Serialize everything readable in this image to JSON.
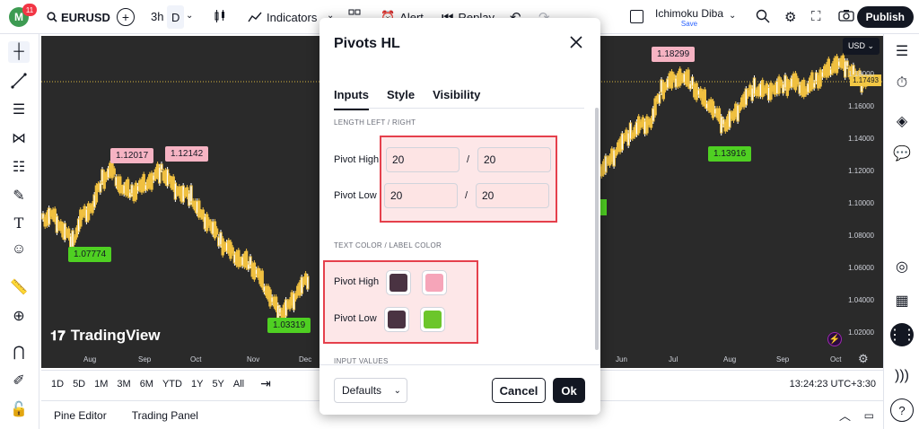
{
  "topbar": {
    "avatar_letter": "M",
    "notifications": "11",
    "symbol": "EURUSD",
    "interval": "3h",
    "interval_d": "D",
    "indicators": "Indicators",
    "alert": "Alert",
    "replay": "Replay",
    "layout_name": "Ichimoku Diba",
    "layout_sub": "Save",
    "publish": "Publish"
  },
  "chart": {
    "currency": "USD",
    "price_tag": "1.17493",
    "price_ticks": [
      "1.18000",
      "1.16000",
      "1.14000",
      "1.12000",
      "1.10000",
      "1.08000",
      "1.06000",
      "1.04000",
      "1.02000"
    ],
    "time_ticks_left": [
      "Aug",
      "Sep",
      "Oct",
      "Nov",
      "Dec"
    ],
    "time_ticks_right": [
      "Jun",
      "Jul",
      "Aug",
      "Sep",
      "Oct"
    ],
    "labels_high": [
      "1.12017",
      "1.12142",
      "1.18299"
    ],
    "labels_low": [
      "1.07774",
      "1.03319",
      "1.13916"
    ],
    "brand": "TradingView"
  },
  "bottom_toolbar": {
    "ranges": [
      "1D",
      "5D",
      "1M",
      "3M",
      "6M",
      "YTD",
      "1Y",
      "5Y",
      "All"
    ],
    "clock": "13:24:23 UTC+3:30"
  },
  "footer": {
    "pine_editor": "Pine Editor",
    "trading_panel": "Trading Panel"
  },
  "dialog": {
    "title": "Pivots HL",
    "tabs": [
      "Inputs",
      "Style",
      "Visibility"
    ],
    "section_length": "LENGTH LEFT / RIGHT",
    "pivot_high_label": "Pivot High",
    "pivot_low_label": "Pivot Low",
    "pivot_high_left": "20",
    "pivot_high_right": "20",
    "pivot_low_left": "20",
    "pivot_low_right": "20",
    "slash": "/",
    "section_color": "TEXT COLOR / LABEL COLOR",
    "color_high_label": "Pivot High",
    "color_low_label": "Pivot Low",
    "section_input_values": "INPUT VALUES",
    "defaults": "Defaults",
    "cancel": "Cancel",
    "ok": "Ok",
    "colors": {
      "high_text": "#4a3342",
      "high_label": "#f6a5b9",
      "low_text": "#4a3342",
      "low_label": "#6cc62b"
    }
  }
}
